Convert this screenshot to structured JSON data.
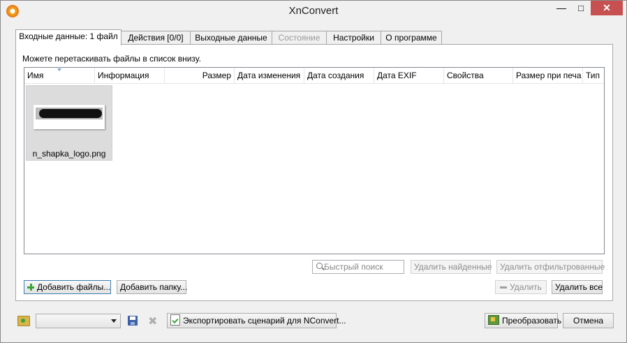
{
  "window": {
    "title": "XnConvert",
    "minimize": "—",
    "maximize": "□",
    "close": "✕"
  },
  "tabs": [
    {
      "label": "Входные данные: 1 файл",
      "active": true,
      "disabled": false
    },
    {
      "label": "Действия [0/0]",
      "active": false,
      "disabled": false
    },
    {
      "label": "Выходные данные",
      "active": false,
      "disabled": false
    },
    {
      "label": "Состояние",
      "active": false,
      "disabled": true
    },
    {
      "label": "Настройки",
      "active": false,
      "disabled": false
    },
    {
      "label": "О программе",
      "active": false,
      "disabled": false
    }
  ],
  "input": {
    "hint": "Можете перетаскивать файлы в список внизу.",
    "columns": [
      "Имя",
      "Информация",
      "Размер",
      "Дата изменения",
      "Дата создания",
      "Дата EXIF",
      "Свойства",
      "Размер при печа",
      "Тип"
    ],
    "files": [
      {
        "name": "n_shapka_logo.png"
      }
    ],
    "search_placeholder": "Быстрый поиск",
    "buttons": {
      "delete_found": "Удалить найденные",
      "delete_filtered": "Удалить отфильтрованные",
      "add_files": "Добавить файлы...",
      "add_folder": "Добавить папку...",
      "delete": "Удалить",
      "delete_all": "Удалить все"
    }
  },
  "footer": {
    "preset_value": "",
    "export_script": "Экспортировать сценарий для NConvert...",
    "convert": "Преобразовать",
    "cancel": "Отмена"
  },
  "colors": {
    "close_button": "#c75050",
    "window_bg": "#f0f0f0",
    "accent": "#3c7fb1"
  }
}
